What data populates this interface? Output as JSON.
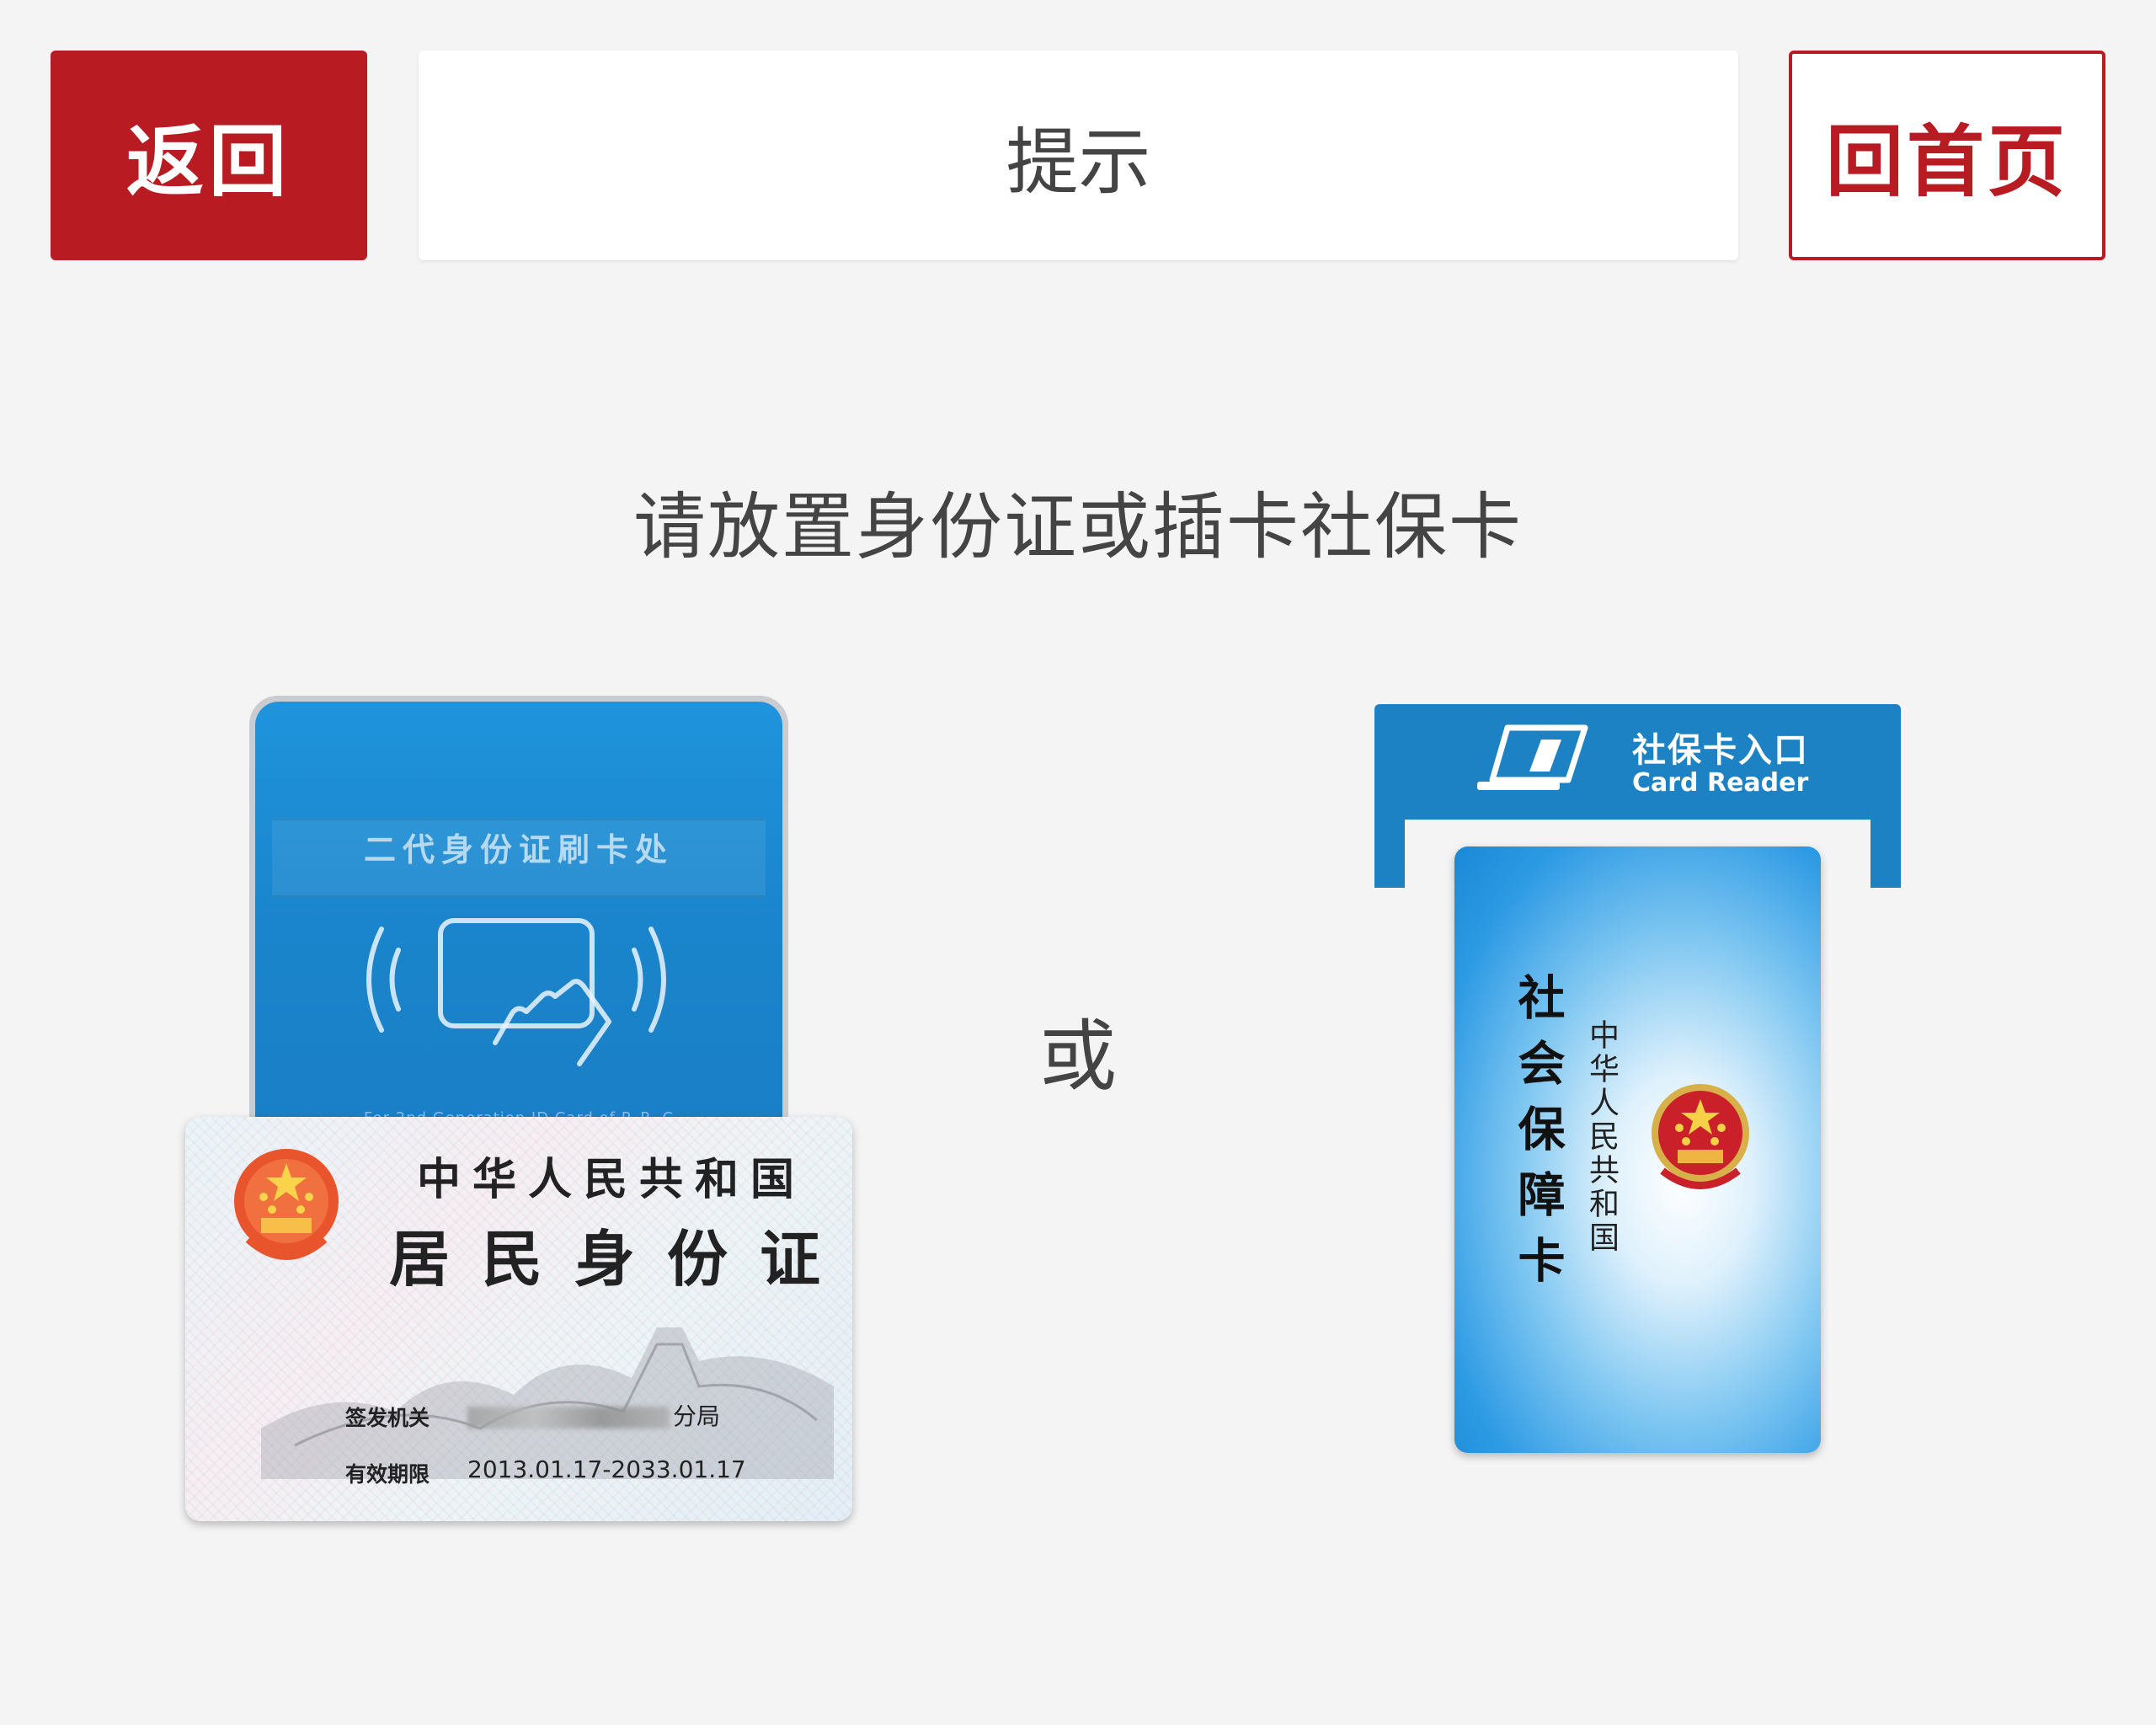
{
  "header": {
    "back_label": "返回",
    "title": "提示",
    "home_label": "回首页"
  },
  "main": {
    "instruction": "请放置身份证或插卡社保卡",
    "or_label": "或"
  },
  "id_reader": {
    "label": "二代身份证刷卡处",
    "footer": "For 2nd Generation ID Card of P. R. C"
  },
  "id_card": {
    "title1": "中华人民共和国",
    "title2": "居民身份证",
    "issuer_label": "签发机关",
    "issuer_suffix": "分局",
    "validity_label": "有效期限",
    "validity_value": "2013.01.17-2033.01.17"
  },
  "social_card_reader": {
    "title": "社保卡入口",
    "subtitle": "Card Reader"
  },
  "social_card": {
    "title": "社会保障卡",
    "subtitle": "中华人民共和国"
  },
  "colors": {
    "primary_red": "#b81c22",
    "reader_blue": "#1d82c4",
    "background": "#f4f4f4"
  }
}
